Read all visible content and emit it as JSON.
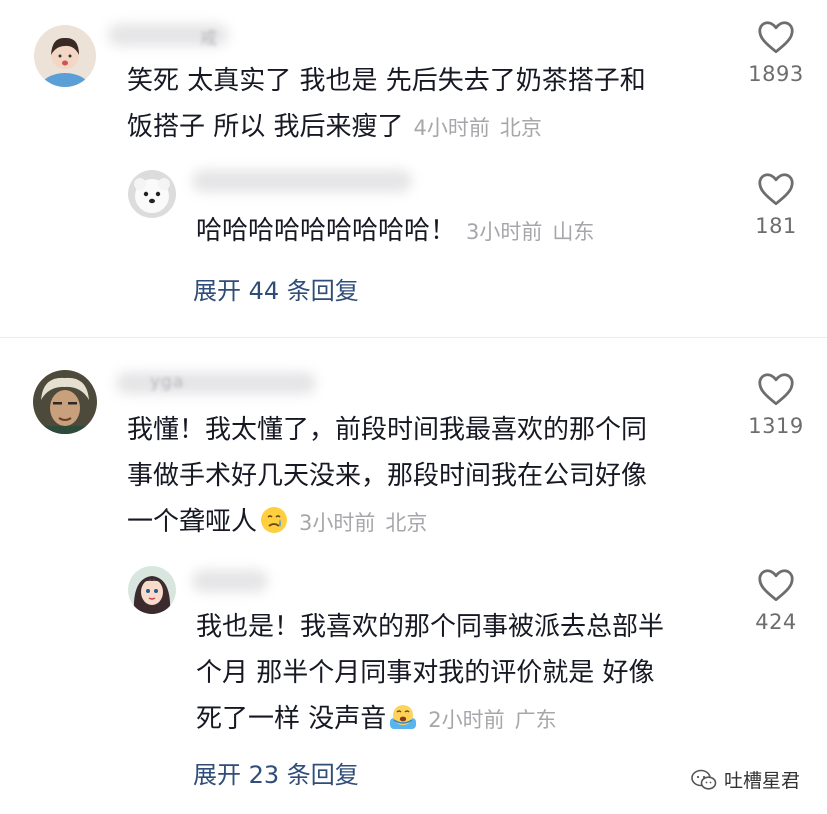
{
  "comments": [
    {
      "body_lines": [
        "笑死 太真实了 我也是 先后失去了奶茶搭子和",
        "饭搭子 所以 我后来瘦了"
      ],
      "time": "4小时前",
      "location": "北京",
      "likes": "1893",
      "avatar_icon": "girl-avatar-icon",
      "reply": {
        "body_lines": [
          "哈哈哈哈哈哈哈哈哈！"
        ],
        "time": "3小时前",
        "location": "山东",
        "likes": "181",
        "avatar_icon": "white-dog-avatar-icon"
      },
      "expand_label": "展开 44 条回复"
    },
    {
      "body_lines": [
        "我懂！我太懂了，前段时间我最喜欢的那个同",
        "事做手术好几天没来，那段时间我在公司好像",
        "一个聋哑人"
      ],
      "time": "3小时前",
      "location": "北京",
      "likes": "1319",
      "emoji": "crying-face-emoji",
      "avatar_icon": "man-headscarf-avatar-icon",
      "reply": {
        "body_lines": [
          "我也是！我喜欢的那个同事被派去总部半",
          "个月 那半个月同事对我的评价就是 好像",
          "死了一样 没声音"
        ],
        "time": "2小时前",
        "location": "广东",
        "likes": "424",
        "emoji": "sobbing-emoji",
        "avatar_icon": "anime-girl-avatar-icon"
      },
      "expand_label": "展开 23 条回复"
    }
  ],
  "watermark": {
    "text": "吐槽星君"
  },
  "colors": {
    "text": "#161823",
    "meta": "#a7a7ab",
    "expand": "#2f4d78",
    "like_count": "#6d6d70"
  }
}
